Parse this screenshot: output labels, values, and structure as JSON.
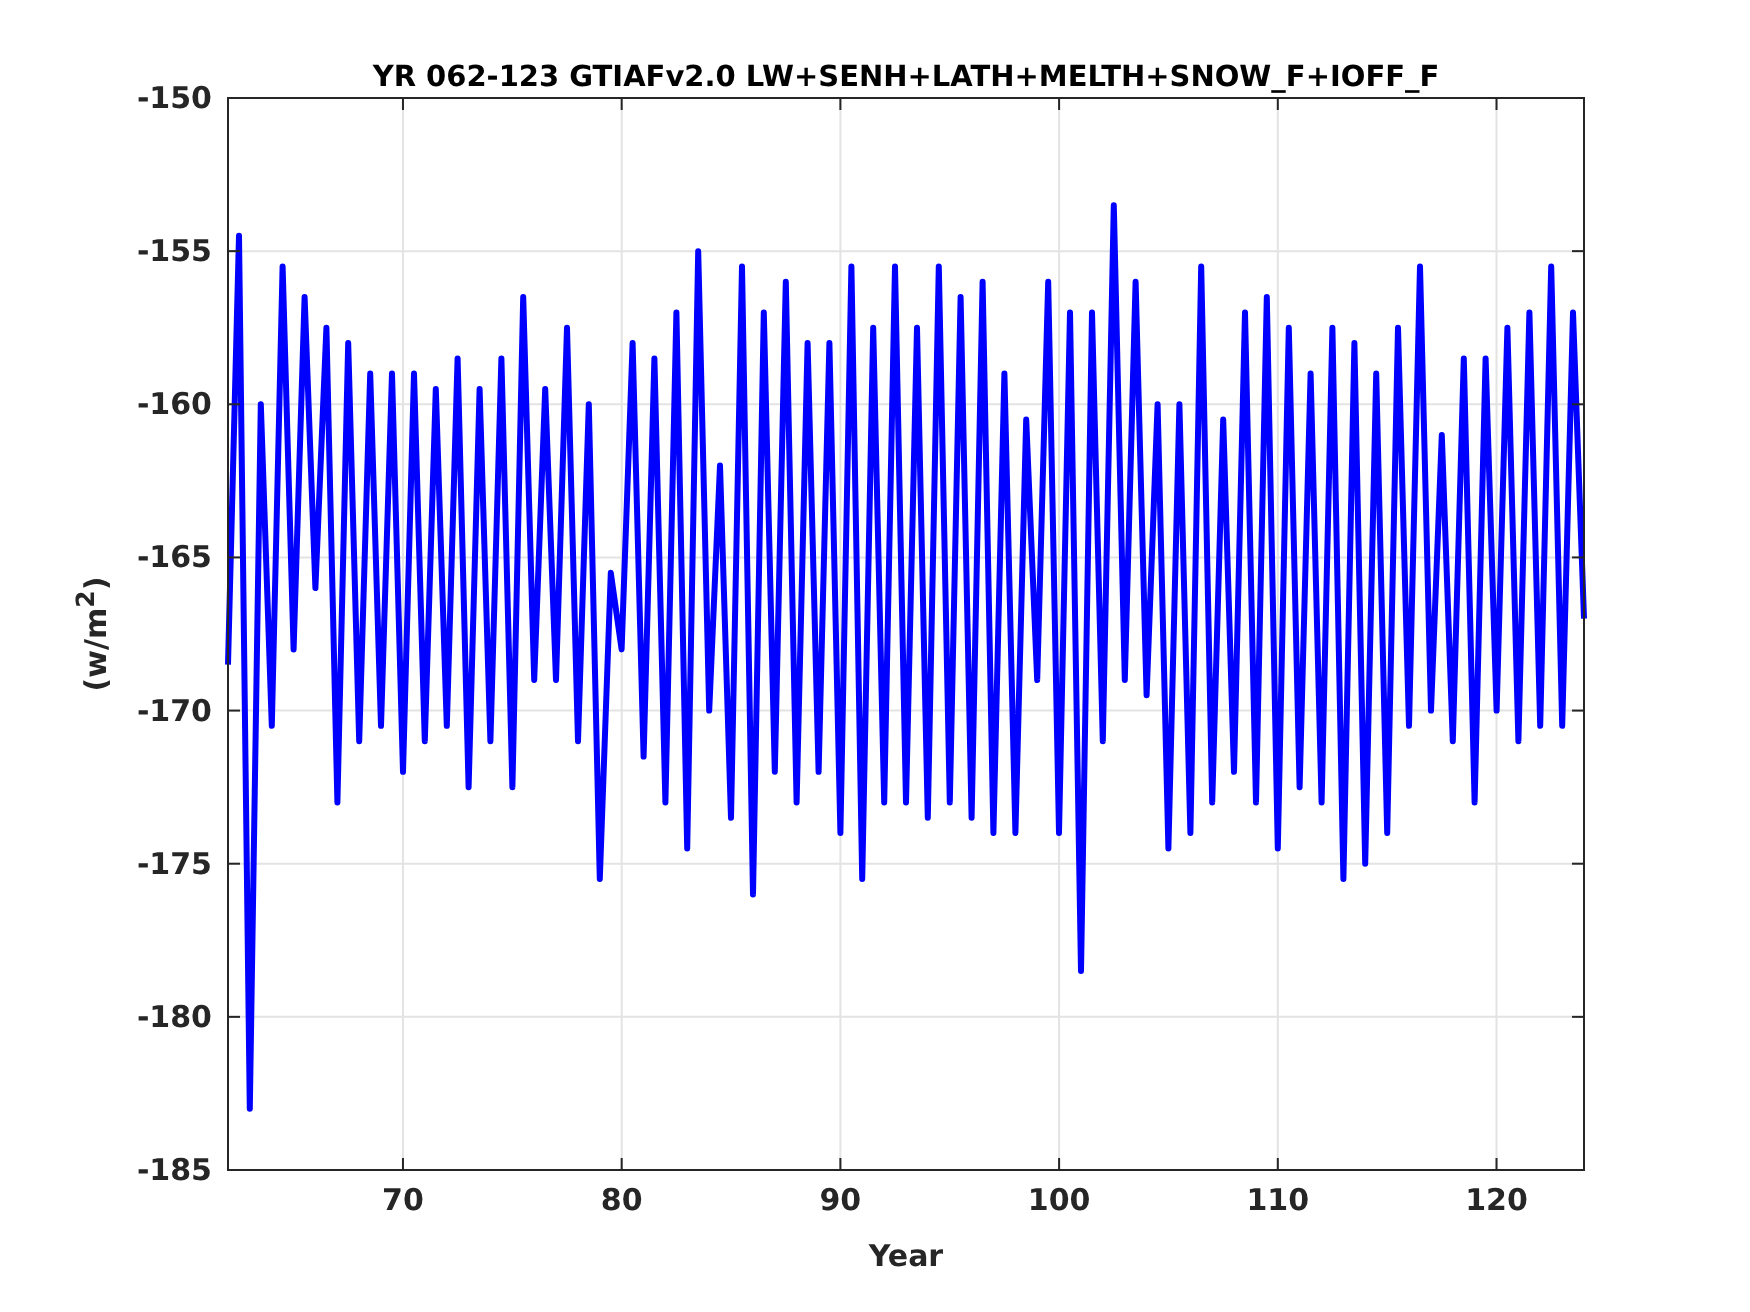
{
  "figure": {
    "chart_data": {
      "type": "line",
      "grid": true,
      "title": "YR 062-123 GTIAFv2.0 LW+SENH+LATH+MELTH+SNOW_F+IOFF_F",
      "xlabel": "Year",
      "ylabel": "(w/m$^{2}$)",
      "xlim": [
        62,
        124
      ],
      "ylim": [
        -185,
        -150
      ],
      "xticks": [
        70,
        80,
        90,
        100,
        110,
        120
      ],
      "yticks": [
        -150,
        -155,
        -160,
        -165,
        -170,
        -175,
        -180,
        -185
      ],
      "x": [
        62,
        62.5,
        63,
        63.5,
        64,
        64.5,
        65,
        65.5,
        66,
        66.5,
        67,
        67.5,
        68,
        68.5,
        69,
        69.5,
        70,
        70.5,
        71,
        71.5,
        72,
        72.5,
        73,
        73.5,
        74,
        74.5,
        75,
        75.5,
        76,
        76.5,
        77,
        77.5,
        78,
        78.5,
        79,
        79.5,
        80,
        80.5,
        81,
        81.5,
        82,
        82.5,
        83,
        83.5,
        84,
        84.5,
        85,
        85.5,
        86,
        86.5,
        87,
        87.5,
        88,
        88.5,
        89,
        89.5,
        90,
        90.5,
        91,
        91.5,
        92,
        92.5,
        93,
        93.5,
        94,
        94.5,
        95,
        95.5,
        96,
        96.5,
        97,
        97.5,
        98,
        98.5,
        99,
        99.5,
        100,
        100.5,
        101,
        101.5,
        102,
        102.5,
        103,
        103.5,
        104,
        104.5,
        105,
        105.5,
        106,
        106.5,
        107,
        107.5,
        108,
        108.5,
        109,
        109.5,
        110,
        110.5,
        111,
        111.5,
        112,
        112.5,
        113,
        113.5,
        114,
        114.5,
        115,
        115.5,
        116,
        116.5,
        117,
        117.5,
        118,
        118.5,
        119,
        119.5,
        120,
        120.5,
        121,
        121.5,
        122,
        122.5,
        123,
        123.5,
        124
      ],
      "series": [
        {
          "color": "#0000ff",
          "values": [
            -168.5,
            -154.5,
            -183,
            -160,
            -170.5,
            -155.5,
            -168,
            -156.5,
            -166,
            -157.5,
            -173,
            -158,
            -171,
            -159,
            -170.5,
            -159,
            -172,
            -159,
            -171,
            -159.5,
            -170.5,
            -158.5,
            -172.5,
            -159.5,
            -171,
            -158.5,
            -172.5,
            -156.5,
            -169,
            -159.5,
            -169,
            -157.5,
            -171,
            -160,
            -175.5,
            -165.5,
            -168,
            -158,
            -171.5,
            -158.5,
            -173,
            -157,
            -174.5,
            -155,
            -170,
            -162,
            -173.5,
            -155.5,
            -176,
            -157,
            -172,
            -156,
            -173,
            -158,
            -172,
            -158,
            -174,
            -155.5,
            -175.5,
            -157.5,
            -173,
            -155.5,
            -173,
            -157.5,
            -173.5,
            -155.5,
            -173,
            -156.5,
            -173.5,
            -156,
            -174,
            -159,
            -174,
            -160.5,
            -169,
            -156,
            -174,
            -157,
            -178.5,
            -157,
            -171,
            -153.5,
            -169,
            -156,
            -169.5,
            -160,
            -174.5,
            -160,
            -174,
            -155.5,
            -173,
            -160.5,
            -172,
            -157,
            -173,
            -156.5,
            -174.5,
            -157.5,
            -172.5,
            -159,
            -173,
            -157.5,
            -175.5,
            -158,
            -175,
            -159,
            -174,
            -157.5,
            -170.5,
            -155.5,
            -170,
            -161,
            -171,
            -158.5,
            -173,
            -158.5,
            -170,
            -157.5,
            -171,
            -157,
            -170.5,
            -155.5,
            -170.5,
            -157,
            -167
          ]
        }
      ]
    }
  }
}
